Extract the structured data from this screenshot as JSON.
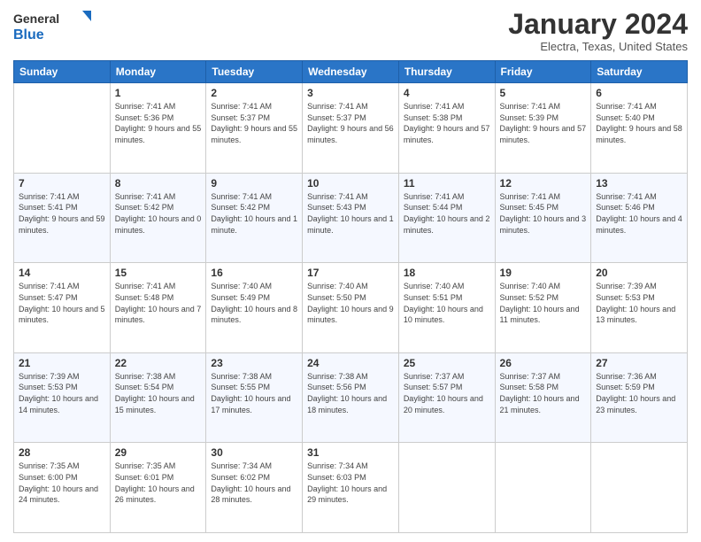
{
  "header": {
    "logo_general": "General",
    "logo_blue": "Blue",
    "month": "January 2024",
    "location": "Electra, Texas, United States"
  },
  "weekdays": [
    "Sunday",
    "Monday",
    "Tuesday",
    "Wednesday",
    "Thursday",
    "Friday",
    "Saturday"
  ],
  "weeks": [
    [
      {
        "day": "",
        "sunrise": "",
        "sunset": "",
        "daylight": ""
      },
      {
        "day": "1",
        "sunrise": "Sunrise: 7:41 AM",
        "sunset": "Sunset: 5:36 PM",
        "daylight": "Daylight: 9 hours and 55 minutes."
      },
      {
        "day": "2",
        "sunrise": "Sunrise: 7:41 AM",
        "sunset": "Sunset: 5:37 PM",
        "daylight": "Daylight: 9 hours and 55 minutes."
      },
      {
        "day": "3",
        "sunrise": "Sunrise: 7:41 AM",
        "sunset": "Sunset: 5:37 PM",
        "daylight": "Daylight: 9 hours and 56 minutes."
      },
      {
        "day": "4",
        "sunrise": "Sunrise: 7:41 AM",
        "sunset": "Sunset: 5:38 PM",
        "daylight": "Daylight: 9 hours and 57 minutes."
      },
      {
        "day": "5",
        "sunrise": "Sunrise: 7:41 AM",
        "sunset": "Sunset: 5:39 PM",
        "daylight": "Daylight: 9 hours and 57 minutes."
      },
      {
        "day": "6",
        "sunrise": "Sunrise: 7:41 AM",
        "sunset": "Sunset: 5:40 PM",
        "daylight": "Daylight: 9 hours and 58 minutes."
      }
    ],
    [
      {
        "day": "7",
        "sunrise": "Sunrise: 7:41 AM",
        "sunset": "Sunset: 5:41 PM",
        "daylight": "Daylight: 9 hours and 59 minutes."
      },
      {
        "day": "8",
        "sunrise": "Sunrise: 7:41 AM",
        "sunset": "Sunset: 5:42 PM",
        "daylight": "Daylight: 10 hours and 0 minutes."
      },
      {
        "day": "9",
        "sunrise": "Sunrise: 7:41 AM",
        "sunset": "Sunset: 5:42 PM",
        "daylight": "Daylight: 10 hours and 1 minute."
      },
      {
        "day": "10",
        "sunrise": "Sunrise: 7:41 AM",
        "sunset": "Sunset: 5:43 PM",
        "daylight": "Daylight: 10 hours and 1 minute."
      },
      {
        "day": "11",
        "sunrise": "Sunrise: 7:41 AM",
        "sunset": "Sunset: 5:44 PM",
        "daylight": "Daylight: 10 hours and 2 minutes."
      },
      {
        "day": "12",
        "sunrise": "Sunrise: 7:41 AM",
        "sunset": "Sunset: 5:45 PM",
        "daylight": "Daylight: 10 hours and 3 minutes."
      },
      {
        "day": "13",
        "sunrise": "Sunrise: 7:41 AM",
        "sunset": "Sunset: 5:46 PM",
        "daylight": "Daylight: 10 hours and 4 minutes."
      }
    ],
    [
      {
        "day": "14",
        "sunrise": "Sunrise: 7:41 AM",
        "sunset": "Sunset: 5:47 PM",
        "daylight": "Daylight: 10 hours and 5 minutes."
      },
      {
        "day": "15",
        "sunrise": "Sunrise: 7:41 AM",
        "sunset": "Sunset: 5:48 PM",
        "daylight": "Daylight: 10 hours and 7 minutes."
      },
      {
        "day": "16",
        "sunrise": "Sunrise: 7:40 AM",
        "sunset": "Sunset: 5:49 PM",
        "daylight": "Daylight: 10 hours and 8 minutes."
      },
      {
        "day": "17",
        "sunrise": "Sunrise: 7:40 AM",
        "sunset": "Sunset: 5:50 PM",
        "daylight": "Daylight: 10 hours and 9 minutes."
      },
      {
        "day": "18",
        "sunrise": "Sunrise: 7:40 AM",
        "sunset": "Sunset: 5:51 PM",
        "daylight": "Daylight: 10 hours and 10 minutes."
      },
      {
        "day": "19",
        "sunrise": "Sunrise: 7:40 AM",
        "sunset": "Sunset: 5:52 PM",
        "daylight": "Daylight: 10 hours and 11 minutes."
      },
      {
        "day": "20",
        "sunrise": "Sunrise: 7:39 AM",
        "sunset": "Sunset: 5:53 PM",
        "daylight": "Daylight: 10 hours and 13 minutes."
      }
    ],
    [
      {
        "day": "21",
        "sunrise": "Sunrise: 7:39 AM",
        "sunset": "Sunset: 5:53 PM",
        "daylight": "Daylight: 10 hours and 14 minutes."
      },
      {
        "day": "22",
        "sunrise": "Sunrise: 7:38 AM",
        "sunset": "Sunset: 5:54 PM",
        "daylight": "Daylight: 10 hours and 15 minutes."
      },
      {
        "day": "23",
        "sunrise": "Sunrise: 7:38 AM",
        "sunset": "Sunset: 5:55 PM",
        "daylight": "Daylight: 10 hours and 17 minutes."
      },
      {
        "day": "24",
        "sunrise": "Sunrise: 7:38 AM",
        "sunset": "Sunset: 5:56 PM",
        "daylight": "Daylight: 10 hours and 18 minutes."
      },
      {
        "day": "25",
        "sunrise": "Sunrise: 7:37 AM",
        "sunset": "Sunset: 5:57 PM",
        "daylight": "Daylight: 10 hours and 20 minutes."
      },
      {
        "day": "26",
        "sunrise": "Sunrise: 7:37 AM",
        "sunset": "Sunset: 5:58 PM",
        "daylight": "Daylight: 10 hours and 21 minutes."
      },
      {
        "day": "27",
        "sunrise": "Sunrise: 7:36 AM",
        "sunset": "Sunset: 5:59 PM",
        "daylight": "Daylight: 10 hours and 23 minutes."
      }
    ],
    [
      {
        "day": "28",
        "sunrise": "Sunrise: 7:35 AM",
        "sunset": "Sunset: 6:00 PM",
        "daylight": "Daylight: 10 hours and 24 minutes."
      },
      {
        "day": "29",
        "sunrise": "Sunrise: 7:35 AM",
        "sunset": "Sunset: 6:01 PM",
        "daylight": "Daylight: 10 hours and 26 minutes."
      },
      {
        "day": "30",
        "sunrise": "Sunrise: 7:34 AM",
        "sunset": "Sunset: 6:02 PM",
        "daylight": "Daylight: 10 hours and 28 minutes."
      },
      {
        "day": "31",
        "sunrise": "Sunrise: 7:34 AM",
        "sunset": "Sunset: 6:03 PM",
        "daylight": "Daylight: 10 hours and 29 minutes."
      },
      {
        "day": "",
        "sunrise": "",
        "sunset": "",
        "daylight": ""
      },
      {
        "day": "",
        "sunrise": "",
        "sunset": "",
        "daylight": ""
      },
      {
        "day": "",
        "sunrise": "",
        "sunset": "",
        "daylight": ""
      }
    ]
  ]
}
